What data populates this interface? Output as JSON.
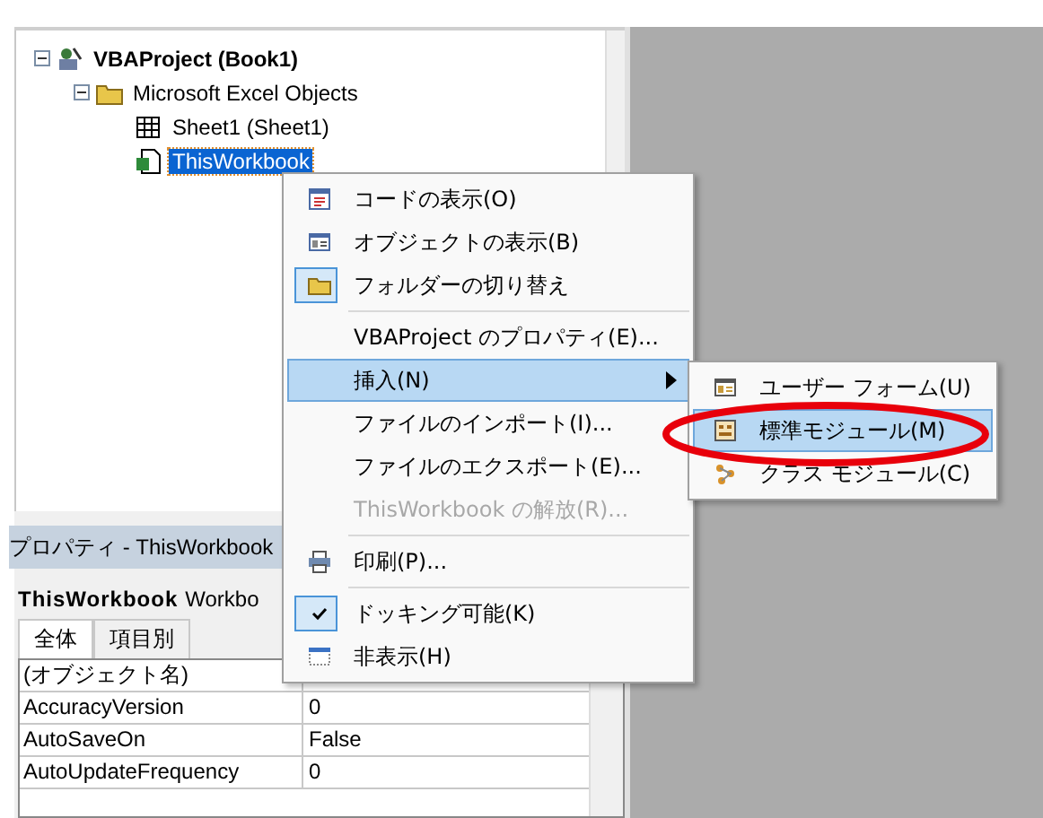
{
  "project_tree": {
    "items": [
      {
        "label": "VBAProject (Book1)",
        "expanded": true,
        "selected": false,
        "children": [
          {
            "label": "Microsoft Excel Objects",
            "expanded": true,
            "selected": false,
            "children": [
              {
                "label": "Sheet1 (Sheet1)",
                "selected": false
              },
              {
                "label": "ThisWorkbook",
                "selected": true
              }
            ]
          }
        ]
      }
    ]
  },
  "properties": {
    "title": "プロパティ - ThisWorkbook",
    "object_name": "ThisWorkbook",
    "object_type": "Workbo",
    "tabs": [
      {
        "label": "全体",
        "selected": true
      },
      {
        "label": "項目別",
        "selected": false
      }
    ],
    "rows": [
      {
        "name": "(オブジェクト名)"
      },
      {
        "name": "AccuracyVersion",
        "value": "0"
      },
      {
        "name": "AutoSaveOn",
        "value": "False"
      },
      {
        "name": "AutoUpdateFrequency",
        "value": "0"
      }
    ]
  },
  "context_menu": {
    "items": [
      {
        "kind": "item",
        "label": "コードの表示(O)",
        "checked": false,
        "selected": false,
        "disabled": false
      },
      {
        "kind": "item",
        "label": "オブジェクトの表示(B)",
        "checked": false,
        "selected": false,
        "disabled": false
      },
      {
        "kind": "item",
        "label": "フォルダーの切り替え",
        "checked": true,
        "selected": false,
        "disabled": false
      },
      {
        "kind": "separator"
      },
      {
        "kind": "item",
        "label": "VBAProject のプロパティ(E)...",
        "checked": false,
        "selected": false,
        "disabled": false
      },
      {
        "kind": "item",
        "label": "挿入(N)",
        "checked": false,
        "selected": true,
        "disabled": false,
        "has_submenu": true
      },
      {
        "kind": "item",
        "label": "ファイルのインポート(I)...",
        "checked": false,
        "selected": false,
        "disabled": false
      },
      {
        "kind": "item",
        "label": "ファイルのエクスポート(E)...",
        "checked": false,
        "selected": false,
        "disabled": false
      },
      {
        "kind": "item",
        "label": "ThisWorkbook の解放(R)...",
        "checked": false,
        "selected": false,
        "disabled": true
      },
      {
        "kind": "separator"
      },
      {
        "kind": "item",
        "label": "印刷(P)...",
        "checked": false,
        "selected": false,
        "disabled": false
      },
      {
        "kind": "separator"
      },
      {
        "kind": "item",
        "label": "ドッキング可能(K)",
        "checked": true,
        "selected": false,
        "disabled": false
      },
      {
        "kind": "item",
        "label": "非表示(H)",
        "checked": false,
        "selected": false,
        "disabled": false
      }
    ]
  },
  "submenu": {
    "items": [
      {
        "label": "ユーザー フォーム(U)",
        "selected": false
      },
      {
        "label": "標準モジュール(M)",
        "selected": true
      },
      {
        "label": "クラス モジュール(C)",
        "selected": false
      }
    ]
  }
}
